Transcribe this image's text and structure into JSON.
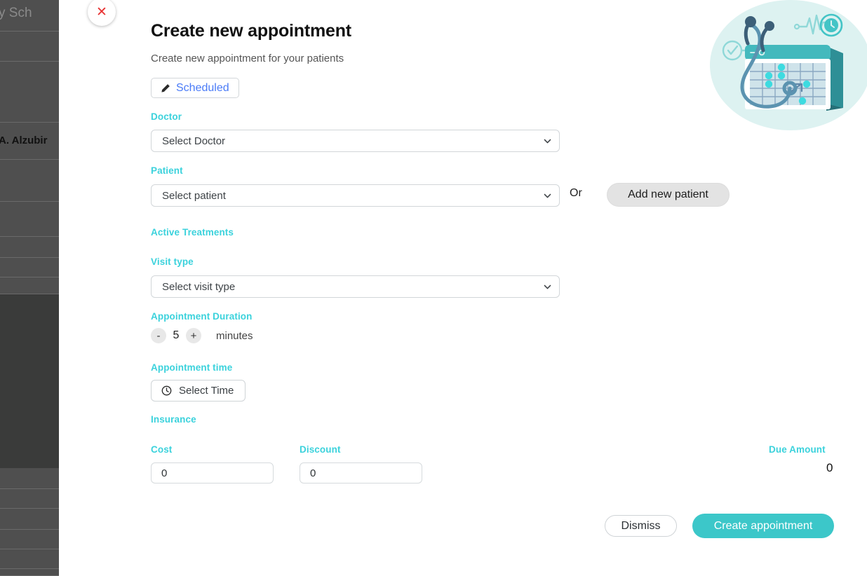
{
  "background": {
    "header_text": "y Sch",
    "patient_name": "A. Alzubir"
  },
  "modal": {
    "close_icon": "close-icon",
    "title": "Create new appointment",
    "subtitle": "Create new appointment for your patients",
    "status": {
      "icon": "pencil-icon",
      "label": "Scheduled",
      "color": "#4a7bf7"
    },
    "doctor": {
      "label": "Doctor",
      "value": "Select Doctor"
    },
    "patient": {
      "label": "Patient",
      "value": "Select patient",
      "or_text": "Or",
      "add_button": "Add new patient"
    },
    "active_treatments": {
      "label": "Active Treatments"
    },
    "visit_type": {
      "label": "Visit type",
      "value": "Select visit type"
    },
    "duration": {
      "label": "Appointment Duration",
      "decrement": "-",
      "value": "5",
      "increment": "+",
      "unit": "minutes"
    },
    "appointment_time": {
      "label": "Appointment time",
      "icon": "clock-icon",
      "button": "Select Time"
    },
    "insurance": {
      "label": "Insurance"
    },
    "cost": {
      "label": "Cost",
      "value": "0",
      "placeholder": "0"
    },
    "discount": {
      "label": "Discount",
      "value": "0",
      "placeholder": "0"
    },
    "due_amount": {
      "label": "Due Amount",
      "value": "0"
    },
    "footer": {
      "dismiss": "Dismiss",
      "create": "Create appointment"
    },
    "illustration": "medical-appointment-calendar-stethoscope-illustration"
  },
  "colors": {
    "label_teal": "#3bd2dc",
    "primary_teal": "#3cc7c9",
    "link_blue": "#4a7bf7",
    "close_red": "#e83232"
  }
}
